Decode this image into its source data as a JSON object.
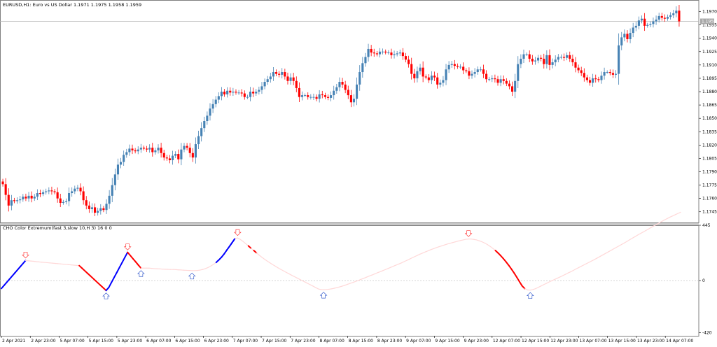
{
  "window": {
    "symbol_line": "EURUSD,H1:  Euro vs US Dollar  1.1971 1.1975 1.1958 1.1959",
    "indicator_line": "CHO Color Extremum(fast 3,slow 10,H 3) 16 0 0",
    "price_badge": "1.1959"
  },
  "colors": {
    "bull": "#4682b4",
    "bear": "#ff0000",
    "osc_up": "#0000ff",
    "osc_down": "#ff0000",
    "osc_neutral": "#ffd8d8",
    "arrow_up": "#3a5fcd",
    "arrow_down": "#ff3a3a",
    "grid": "#c0c0c0",
    "price_line": "#b4b4b4"
  },
  "chart_data": [
    {
      "type": "candlestick",
      "name": "EURUSD,H1",
      "ylim": [
        1.1733,
        1.1983
      ],
      "y_ticks": [
        "1.1970",
        "1.1955",
        "1.1940",
        "1.1925",
        "1.1910",
        "1.1895",
        "1.1880",
        "1.1865",
        "1.1850",
        "1.1835",
        "1.1820",
        "1.1805",
        "1.1790",
        "1.1775",
        "1.1760",
        "1.1745"
      ],
      "current_price": 1.1959,
      "closes": [
        1.1776,
        1.1764,
        1.1752,
        1.1758,
        1.1757,
        1.1758,
        1.1759,
        1.1762,
        1.176,
        1.1763,
        1.176,
        1.1762,
        1.1766,
        1.1765,
        1.1767,
        1.1768,
        1.1769,
        1.1768,
        1.1767,
        1.176,
        1.1755,
        1.1756,
        1.1757,
        1.1766,
        1.1768,
        1.1771,
        1.1772,
        1.1768,
        1.1758,
        1.1752,
        1.1748,
        1.175,
        1.1744,
        1.1746,
        1.1749,
        1.1747,
        1.1754,
        1.1763,
        1.1775,
        1.1787,
        1.1798,
        1.1801,
        1.1809,
        1.1812,
        1.1816,
        1.1814,
        1.1813,
        1.1815,
        1.1817,
        1.1816,
        1.1815,
        1.1817,
        1.1812,
        1.1814,
        1.1817,
        1.1811,
        1.1806,
        1.1805,
        1.1803,
        1.1808,
        1.181,
        1.1804,
        1.1815,
        1.1819,
        1.1817,
        1.1811,
        1.1806,
        1.1821,
        1.183,
        1.1839,
        1.1847,
        1.1853,
        1.1861,
        1.1866,
        1.1871,
        1.1875,
        1.188,
        1.1877,
        1.1881,
        1.1879,
        1.188,
        1.1879,
        1.1879,
        1.1878,
        1.1874,
        1.1874,
        1.188,
        1.1878,
        1.188,
        1.1882,
        1.1886,
        1.1891,
        1.1894,
        1.1897,
        1.1902,
        1.19,
        1.1899,
        1.1902,
        1.1897,
        1.1892,
        1.1896,
        1.1892,
        1.1884,
        1.1874,
        1.1876,
        1.1876,
        1.1874,
        1.1874,
        1.1874,
        1.1872,
        1.1877,
        1.1876,
        1.1874,
        1.1873,
        1.1876,
        1.1881,
        1.1885,
        1.1891,
        1.1888,
        1.1882,
        1.1876,
        1.1868,
        1.1872,
        1.1888,
        1.1902,
        1.1912,
        1.1919,
        1.1928,
        1.1924,
        1.1923,
        1.1922,
        1.1925,
        1.1925,
        1.1924,
        1.1924,
        1.1921,
        1.1922,
        1.1923,
        1.1924,
        1.192,
        1.1916,
        1.1911,
        1.19,
        1.1895,
        1.1903,
        1.1907,
        1.1897,
        1.1896,
        1.1893,
        1.1898,
        1.1896,
        1.1888,
        1.189,
        1.1893,
        1.1905,
        1.191,
        1.1911,
        1.1909,
        1.1908,
        1.1908,
        1.1904,
        1.1903,
        1.1898,
        1.19,
        1.1902,
        1.1905,
        1.1905,
        1.19,
        1.1894,
        1.1894,
        1.1895,
        1.1894,
        1.189,
        1.1894,
        1.1892,
        1.1889,
        1.1886,
        1.188,
        1.1892,
        1.1911,
        1.1917,
        1.1922,
        1.1922,
        1.1917,
        1.1914,
        1.1915,
        1.1918,
        1.1917,
        1.1911,
        1.1921,
        1.191,
        1.1913,
        1.1916,
        1.1919,
        1.1919,
        1.1918,
        1.1921,
        1.1917,
        1.1913,
        1.1907,
        1.1904,
        1.1901,
        1.1896,
        1.1893,
        1.189,
        1.1895,
        1.1894,
        1.1893,
        1.1898,
        1.1902,
        1.1902,
        1.1901,
        1.1899,
        1.19,
        1.1932,
        1.1941,
        1.1945,
        1.1939,
        1.1946,
        1.1952,
        1.1954,
        1.196,
        1.1962,
        1.1954,
        1.1955,
        1.1956,
        1.1959,
        1.1961,
        1.1965,
        1.1963,
        1.1962,
        1.1964,
        1.1966,
        1.1968,
        1.1971,
        1.1959
      ]
    },
    {
      "type": "line",
      "name": "CHO Color Extremum(fast 3,slow 10,H 3) 16 0 0",
      "ylim": [
        -0.00445,
        0.00445
      ],
      "y_ticks": [
        "445",
        "0",
        "-420"
      ],
      "values": [
        -64,
        -39,
        -14,
        11,
        36,
        61,
        86,
        111,
        136,
        161,
        159,
        157,
        155,
        152,
        150,
        148,
        146,
        144,
        142,
        140,
        138,
        136,
        134,
        132,
        130,
        128,
        126,
        124,
        122,
        120,
        100,
        80,
        60,
        40,
        20,
        0,
        -20,
        -40,
        -60,
        -80,
        -56,
        -15,
        25,
        65,
        106,
        146,
        187,
        227,
        202,
        176,
        151,
        125,
        100,
        100,
        100,
        100,
        98,
        96,
        95,
        94,
        92,
        91,
        90,
        89,
        89,
        88,
        86,
        85,
        83,
        82,
        81,
        80,
        80,
        81,
        84,
        89,
        96,
        105,
        117,
        130,
        146,
        166,
        188,
        215,
        246,
        276,
        307,
        338,
        343,
        331,
        315,
        297,
        279,
        260,
        242,
        223,
        205,
        188,
        172,
        157,
        143,
        129,
        116,
        103,
        91,
        79,
        67,
        56,
        44,
        33,
        22,
        11,
        0,
        -11,
        -22,
        -33,
        -44,
        -56,
        -67,
        -73,
        -74,
        -73,
        -70,
        -67,
        -62,
        -57,
        -51,
        -45,
        -38,
        -30,
        -22,
        -15,
        -7,
        1,
        10,
        18,
        27,
        36,
        44,
        53,
        62,
        70,
        79,
        88,
        97,
        106,
        115,
        124,
        133,
        142,
        152,
        162,
        172,
        183,
        193,
        203,
        213,
        222,
        231,
        240,
        249,
        257,
        265,
        272,
        279,
        286,
        293,
        299,
        305,
        311,
        317,
        322,
        327,
        332,
        334,
        334,
        331,
        327,
        320,
        312,
        302,
        290,
        276,
        260,
        242,
        222,
        200,
        176,
        150,
        122,
        92,
        60,
        26,
        -10,
        -44,
        -66,
        -76,
        -77,
        -73,
        -65,
        -55,
        -44,
        -33,
        -23,
        -12,
        -2,
        8,
        18,
        28,
        38,
        49,
        60,
        70,
        81,
        93,
        104,
        115,
        126,
        137,
        148,
        159,
        170,
        182,
        194,
        206,
        218,
        230,
        242,
        254,
        266,
        278,
        290,
        302,
        315,
        328,
        341,
        353,
        366,
        378,
        390,
        402,
        414,
        427,
        439,
        451,
        463,
        476,
        488,
        499,
        510,
        520,
        530,
        540,
        550
      ]
    }
  ],
  "x_axis": {
    "labels": [
      "2 Apr 2021",
      "2 Apr 23:00",
      "5 Apr 07:00",
      "5 Apr 15:00",
      "5 Apr 23:00",
      "6 Apr 07:00",
      "6 Apr 15:00",
      "6 Apr 23:00",
      "7 Apr 07:00",
      "7 Apr 15:00",
      "7 Apr 23:00",
      "8 Apr 07:00",
      "8 Apr 15:00",
      "8 Apr 23:00",
      "9 Apr 07:00",
      "9 Apr 15:00",
      "9 Apr 23:00",
      "12 Apr 07:00",
      "12 Apr 15:00",
      "12 Apr 23:00",
      "13 Apr 07:00",
      "13 Apr 15:00",
      "13 Apr 23:00",
      "14 Apr 07:00"
    ]
  }
}
